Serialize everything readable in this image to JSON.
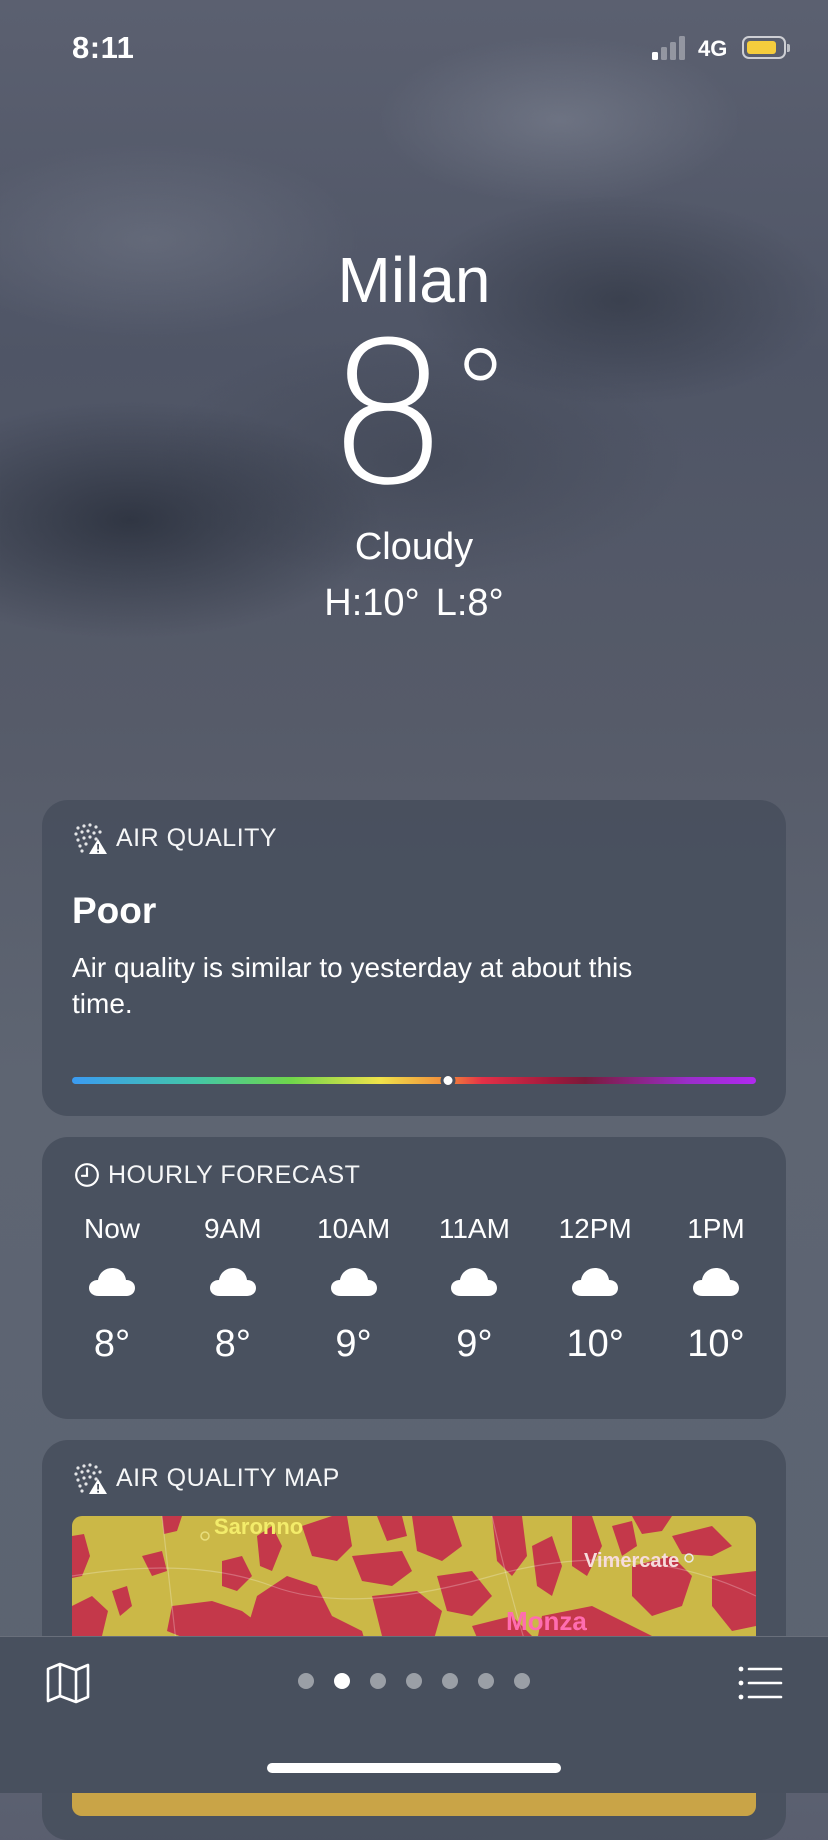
{
  "status_bar": {
    "time": "8:11",
    "network": "4G",
    "battery_color": "#f5cd3d"
  },
  "location": {
    "city": "Milan",
    "temperature": "8",
    "temperature_unit": "°",
    "condition": "Cloudy",
    "high": "H:10°",
    "low": "L:8°"
  },
  "air_quality": {
    "header": "AIR QUALITY",
    "header_icon": "air-quality-icon",
    "level": "Poor",
    "description": "Air quality is similar to yesterday at about this time.",
    "index_fraction": 0.55
  },
  "hourly_forecast": {
    "header": "HOURLY FORECAST",
    "header_icon": "clock-icon",
    "hours": [
      {
        "time": "Now",
        "icon": "cloud-icon",
        "temp": "8°"
      },
      {
        "time": "9AM",
        "icon": "cloud-icon",
        "temp": "8°"
      },
      {
        "time": "10AM",
        "icon": "cloud-icon",
        "temp": "9°"
      },
      {
        "time": "11AM",
        "icon": "cloud-icon",
        "temp": "9°"
      },
      {
        "time": "12PM",
        "icon": "cloud-icon",
        "temp": "10°"
      },
      {
        "time": "1PM",
        "icon": "cloud-icon",
        "temp": "10°"
      }
    ]
  },
  "air_quality_map": {
    "header": "AIR QUALITY MAP",
    "header_icon": "air-quality-icon",
    "places": {
      "saronno": "Saronno",
      "vimercate": "Vimercate",
      "monza": "Monza"
    },
    "colors": {
      "moderate": "#cbb847",
      "poor": "#c4384a"
    }
  },
  "bottom_bar": {
    "map_icon": "map-icon",
    "list_icon": "list-icon",
    "page_count": 7,
    "active_page": 2
  }
}
